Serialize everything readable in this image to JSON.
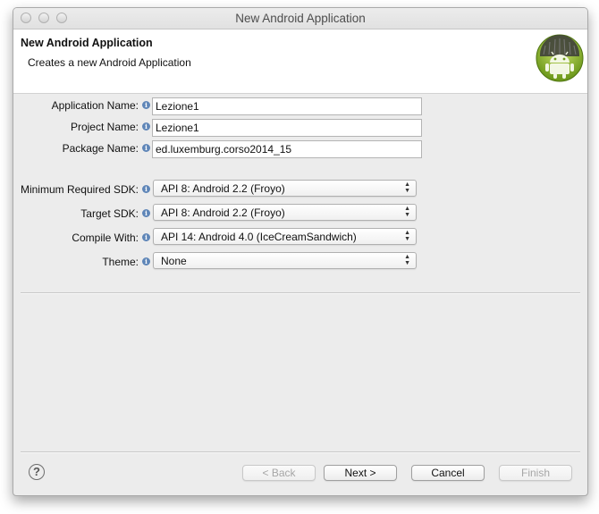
{
  "window": {
    "title": "New Android Application"
  },
  "header": {
    "title": "New Android Application",
    "subtitle": "Creates a new Android Application"
  },
  "info_glyph": "i",
  "form": {
    "application_name": {
      "label": "Application Name:",
      "value": "Lezione1"
    },
    "project_name": {
      "label": "Project Name:",
      "value": "Lezione1"
    },
    "package_name": {
      "label": "Package Name:",
      "value": "ed.luxemburg.corso2014_15"
    },
    "min_sdk": {
      "label": "Minimum Required SDK:",
      "value": "API 8: Android 2.2 (Froyo)"
    },
    "target_sdk": {
      "label": "Target SDK:",
      "value": "API 8: Android 2.2 (Froyo)"
    },
    "compile_with": {
      "label": "Compile With:",
      "value": "API 14: Android 4.0 (IceCreamSandwich)"
    },
    "theme": {
      "label": "Theme:",
      "value": "None"
    }
  },
  "footer": {
    "help": "?",
    "back": "< Back",
    "next": "Next >",
    "cancel": "Cancel",
    "finish": "Finish"
  },
  "colors": {
    "window_bg": "#ececec",
    "android_green": "#a4c639",
    "info_blue": "#5f86b8"
  },
  "icons": {
    "window_controls": [
      "close-icon",
      "minimize-icon",
      "zoom-icon"
    ],
    "logo": "android-logo-icon",
    "info": "info-icon",
    "select": "chevron-up-down-icon",
    "help": "help-icon"
  }
}
